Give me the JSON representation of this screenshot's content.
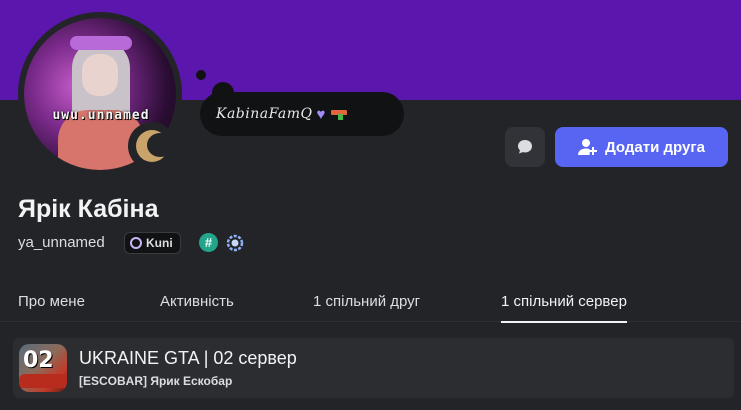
{
  "banner": {
    "color": "#5b16ad"
  },
  "avatar": {
    "watermark": "uwu.unnamed"
  },
  "status": {
    "type": "idle",
    "icon": "moon-icon",
    "color": "#c9a36a"
  },
  "custom_status": {
    "text": "KabinaFamQ",
    "emojis": [
      "purple-heart-icon",
      "water-gun-icon"
    ]
  },
  "actions": {
    "message_icon": "chat-bubble-icon",
    "add_friend_label": "Додати друга"
  },
  "profile": {
    "display_name": "Ярік Кабіна",
    "username": "ya_unnamed",
    "tag_label": "Kuni",
    "badges": [
      "hashtag-badge-icon",
      "laurel-badge-icon"
    ]
  },
  "tabs": [
    {
      "label": "Про мене",
      "active": false
    },
    {
      "label": "Активність",
      "active": false
    },
    {
      "label": "1 спільний друг",
      "active": false
    },
    {
      "label": "1 спільний сервер",
      "active": true
    }
  ],
  "mutual_servers": [
    {
      "icon_text": "02",
      "name": "UKRAINE GTA | 02 сервер",
      "nickname": "[ESCOBAR] Ярик Ескобар"
    }
  ]
}
